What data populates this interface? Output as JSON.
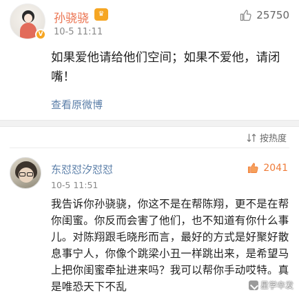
{
  "post": {
    "author": "孙骁骁",
    "time": "10-5 11:11",
    "like_count": "25750",
    "body": "如果爱他请给他们空间；如果不爱他，请闭嘴！",
    "view_source_label": "查看原微博"
  },
  "sort": {
    "label": "按热度"
  },
  "comment": {
    "author": "东怼怼汐怼怼",
    "time": "10-5 11:51",
    "like_count": "2041",
    "body": "我告诉你孙骁骁，你这不是在帮陈翔，更不是在帮你闺蜜。你反而会害了他们，也不知道有你什么事儿。对陈翔跟毛晓彤而言，最好的方式是好聚好散息事宁人，你像个跳梁小丑一样跳出来，是希望马上把你闺蜜牵扯进来吗？我可以帮你手动哎特。真是唯恐天下不乱"
  },
  "watermark": {
    "text": "星学辛发"
  },
  "colors": {
    "author_name": "#eb7350",
    "link_blue": "#5a7ea8",
    "like_orange": "#ef7b38"
  }
}
